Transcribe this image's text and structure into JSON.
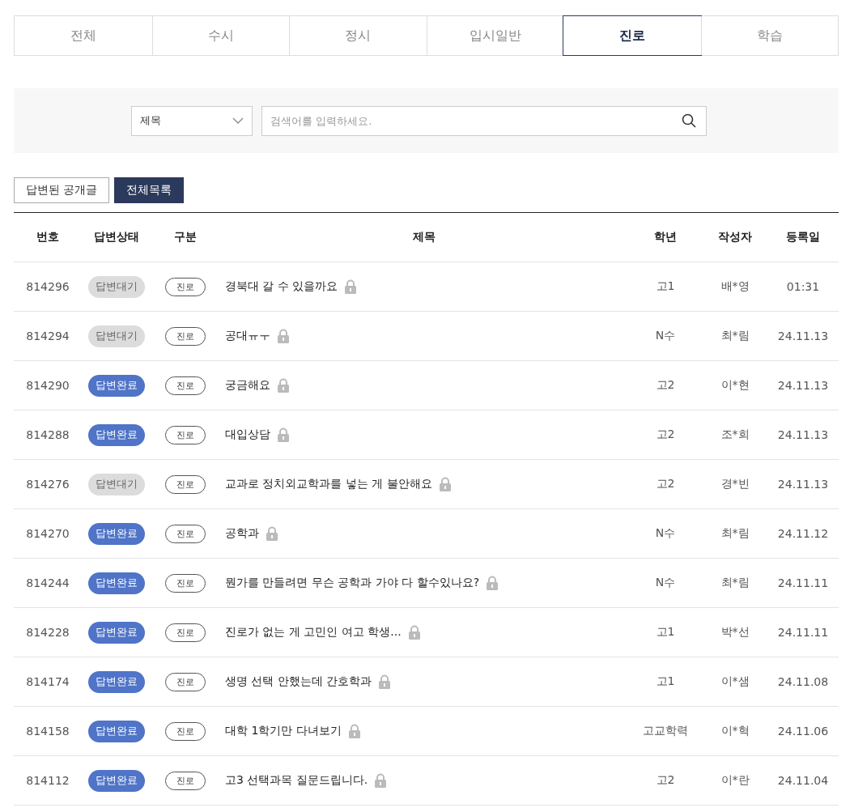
{
  "tabs": [
    {
      "label": "전체",
      "selected": false
    },
    {
      "label": "수시",
      "selected": false
    },
    {
      "label": "정시",
      "selected": false
    },
    {
      "label": "입시일반",
      "selected": false
    },
    {
      "label": "진로",
      "selected": true
    },
    {
      "label": "학습",
      "selected": false
    }
  ],
  "search": {
    "select_value": "제목",
    "placeholder": "검색어를 입력하세요."
  },
  "filters": [
    {
      "label": "답변된 공개글",
      "selected": false
    },
    {
      "label": "전체목록",
      "selected": true
    }
  ],
  "table": {
    "columns": [
      "번호",
      "답변상태",
      "구분",
      "제목",
      "학년",
      "작성자",
      "등록일"
    ],
    "rows": [
      {
        "number": "814296",
        "status": "답변대기",
        "answered": false,
        "category": "진로",
        "title": "경북대 갈 수 있을까요",
        "locked": true,
        "grade": "고1",
        "author": "배*영",
        "date": "01:31"
      },
      {
        "number": "814294",
        "status": "답변대기",
        "answered": false,
        "category": "진로",
        "title": "공대ㅠㅜ",
        "locked": true,
        "grade": "N수",
        "author": "최*림",
        "date": "24.11.13"
      },
      {
        "number": "814290",
        "status": "답변완료",
        "answered": true,
        "category": "진로",
        "title": "궁금해요",
        "locked": true,
        "grade": "고2",
        "author": "이*현",
        "date": "24.11.13"
      },
      {
        "number": "814288",
        "status": "답변완료",
        "answered": true,
        "category": "진로",
        "title": "대입상담",
        "locked": true,
        "grade": "고2",
        "author": "조*희",
        "date": "24.11.13"
      },
      {
        "number": "814276",
        "status": "답변대기",
        "answered": false,
        "category": "진로",
        "title": "교과로 정치외교학과를 넣는 게 불안해요",
        "locked": true,
        "grade": "고2",
        "author": "경*빈",
        "date": "24.11.13"
      },
      {
        "number": "814270",
        "status": "답변완료",
        "answered": true,
        "category": "진로",
        "title": "공학과",
        "locked": true,
        "grade": "N수",
        "author": "최*림",
        "date": "24.11.12"
      },
      {
        "number": "814244",
        "status": "답변완료",
        "answered": true,
        "category": "진로",
        "title": "뭔가를 만들려면 무슨 공학과 가야 다 할수있나요?",
        "locked": true,
        "grade": "N수",
        "author": "최*림",
        "date": "24.11.11"
      },
      {
        "number": "814228",
        "status": "답변완료",
        "answered": true,
        "category": "진로",
        "title": "진로가 없는 게 고민인 여고 학생...",
        "locked": true,
        "grade": "고1",
        "author": "박*선",
        "date": "24.11.11"
      },
      {
        "number": "814174",
        "status": "답변완료",
        "answered": true,
        "category": "진로",
        "title": "생명 선택 안했는데 간호학과",
        "locked": true,
        "grade": "고1",
        "author": "이*샘",
        "date": "24.11.08"
      },
      {
        "number": "814158",
        "status": "답변완료",
        "answered": true,
        "category": "진로",
        "title": "대학 1학기만 다녀보기",
        "locked": true,
        "grade": "고교학력",
        "author": "이*혁",
        "date": "24.11.06"
      },
      {
        "number": "814112",
        "status": "답변완료",
        "answered": true,
        "category": "진로",
        "title": "고3 선택과목 질문드립니다.",
        "locked": true,
        "grade": "고2",
        "author": "이*란",
        "date": "24.11.04"
      }
    ]
  }
}
